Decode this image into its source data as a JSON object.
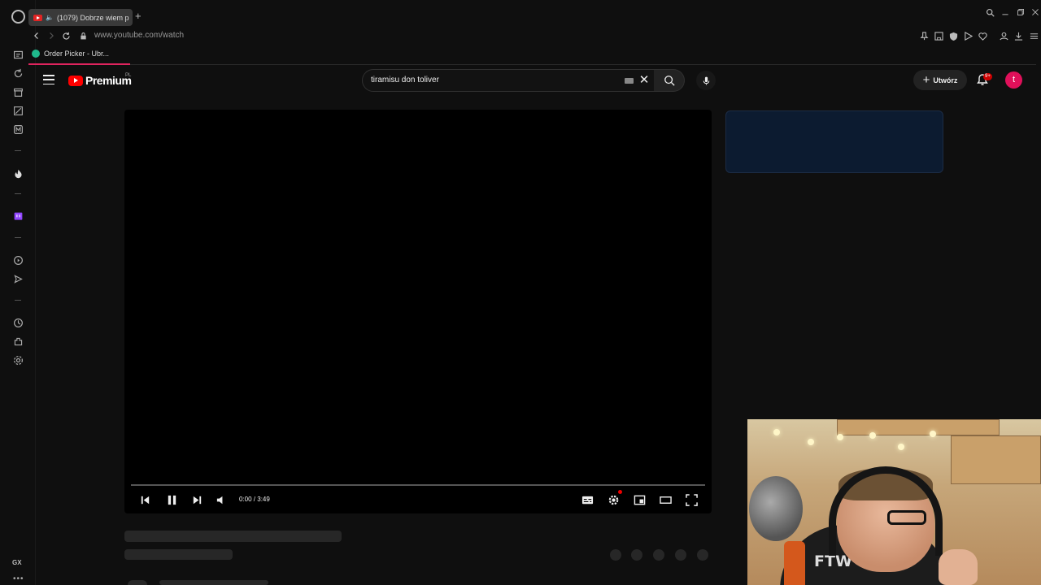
{
  "browser": {
    "tab_title": "(1079) Dobrze wiem p",
    "new_tab": "+",
    "url": "www.youtube.com/watch",
    "bookmark": "Order Picker - Ubr...",
    "sidebar_label": "GX",
    "sidebar_more": "•••"
  },
  "youtube": {
    "logo_word": "Premium",
    "country": "PL",
    "search_value": "tiramisu don toliver",
    "create_label": "Utwórz",
    "notif_badge": "9+",
    "avatar_letter": "t"
  },
  "player": {
    "time": "0:00 / 3:49",
    "progress": 0
  },
  "webcam": {
    "chair_text": "FTW"
  },
  "colors": {
    "yt_red": "#ff0000",
    "avatar": "#e0105a",
    "ad_bg": "#0c1b30",
    "progress": "#e0245e"
  }
}
